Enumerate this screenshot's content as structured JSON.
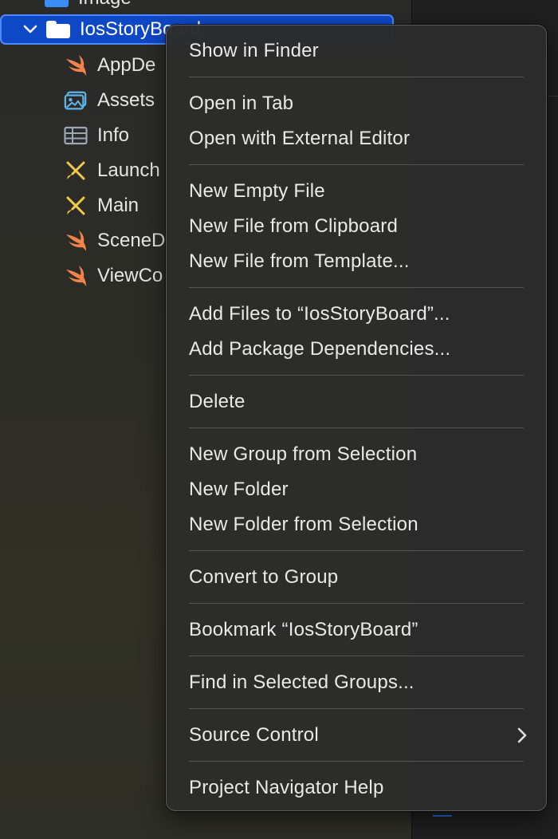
{
  "navigator": {
    "partial_row": {
      "label": "Image",
      "icon": "folder-icon",
      "color": "#3a8ef3"
    },
    "selected_row": {
      "label": "IosStoryBoard",
      "icon": "folder-icon",
      "expanded": true,
      "highlight_color": "#0f48c6"
    },
    "items": [
      {
        "label": "AppDe",
        "icon": "swift-icon"
      },
      {
        "label": "Assets",
        "icon": "asset-catalog-icon"
      },
      {
        "label": "Info",
        "icon": "plist-icon"
      },
      {
        "label": "Launch",
        "icon": "storyboard-icon"
      },
      {
        "label": "Main",
        "icon": "storyboard-icon"
      },
      {
        "label": "SceneD",
        "icon": "swift-icon"
      },
      {
        "label": "ViewCo",
        "icon": "swift-icon"
      }
    ]
  },
  "context_menu": {
    "groups": [
      [
        "Show in Finder"
      ],
      [
        "Open in Tab",
        "Open with External Editor"
      ],
      [
        "New Empty File",
        "New File from Clipboard",
        "New File from Template..."
      ],
      [
        "Add Files to “IosStoryBoard”...",
        "Add Package Dependencies..."
      ],
      [
        "Delete"
      ],
      [
        "New Group from Selection",
        "New Folder",
        "New Folder from Selection"
      ],
      [
        "Convert to Group"
      ],
      [
        "Bookmark “IosStoryBoard”"
      ],
      [
        "Find in Selected Groups..."
      ],
      [
        "Source Control"
      ],
      [
        "Project Navigator Help"
      ]
    ],
    "submenu_items": [
      "Source Control"
    ],
    "submenu_icon": "chevron-right-icon"
  },
  "colors": {
    "swift": "#f5824a",
    "storyboard": "#f2c94c",
    "asset": "#5fb3e8",
    "plist": "#9aa7b4",
    "selection": "#0f48c6",
    "selection_border": "#4f88ff"
  }
}
